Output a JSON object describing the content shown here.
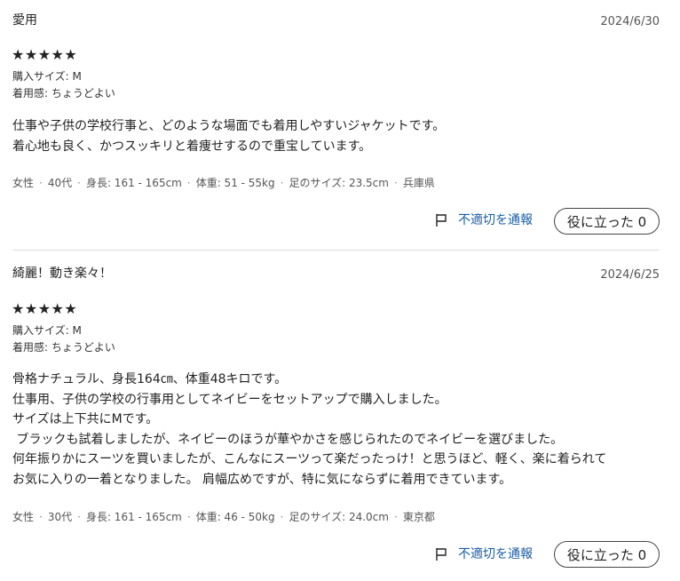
{
  "reviews": [
    {
      "title": "愛用",
      "date": "2024/6/30",
      "stars": "★★★★★",
      "rating": 5,
      "purchase_size": "購入サイズ: M",
      "fit": "着用感: ちょうどよい",
      "body": "仕事や子供の学校行事と、どのような場面でも着用しやすいジャケットです。\n着心地も良く、かつスッキリと着痩せするので重宝しています。",
      "profile": {
        "gender": "女性",
        "age": "40代",
        "height": "身長: 161 - 165cm",
        "weight": "体重: 51 - 55kg",
        "foot": "足のサイズ: 23.5cm",
        "region": "兵庫県"
      },
      "report_label": "不適切を通報",
      "helpful_label": "役に立った 0"
    },
    {
      "title": "綺麗！動き楽々！",
      "date": "2024/6/25",
      "stars": "★★★★★",
      "rating": 5,
      "purchase_size": "購入サイズ: M",
      "fit": "着用感: ちょうどよい",
      "body": "骨格ナチュラル、身長164㎝、体重48キロです。\n仕事用、子供の学校の行事用としてネイビーをセットアップで購入しました。\nサイズは上下共にMです。\n ブラックも試着しましたが、ネイビーのほうが華やかさを感じられたのでネイビーを選びました。\n何年振りかにスーツを買いましたが、こんなにスーツって楽だったっけ！と思うほど、軽く、楽に着られて\nお気に入りの一着となりました。 肩幅広めですが、特に気にならずに着用できています。",
      "profile": {
        "gender": "女性",
        "age": "30代",
        "height": "身長: 161 - 165cm",
        "weight": "体重: 46 - 50kg",
        "foot": "足のサイズ: 24.0cm",
        "region": "東京都"
      },
      "report_label": "不適切を通報",
      "helpful_label": "役に立った 0"
    }
  ],
  "icons": {
    "report": "flag-icon"
  },
  "colors": {
    "link": "#1a5ea8",
    "text": "#222222",
    "divider": "#dddddd"
  }
}
